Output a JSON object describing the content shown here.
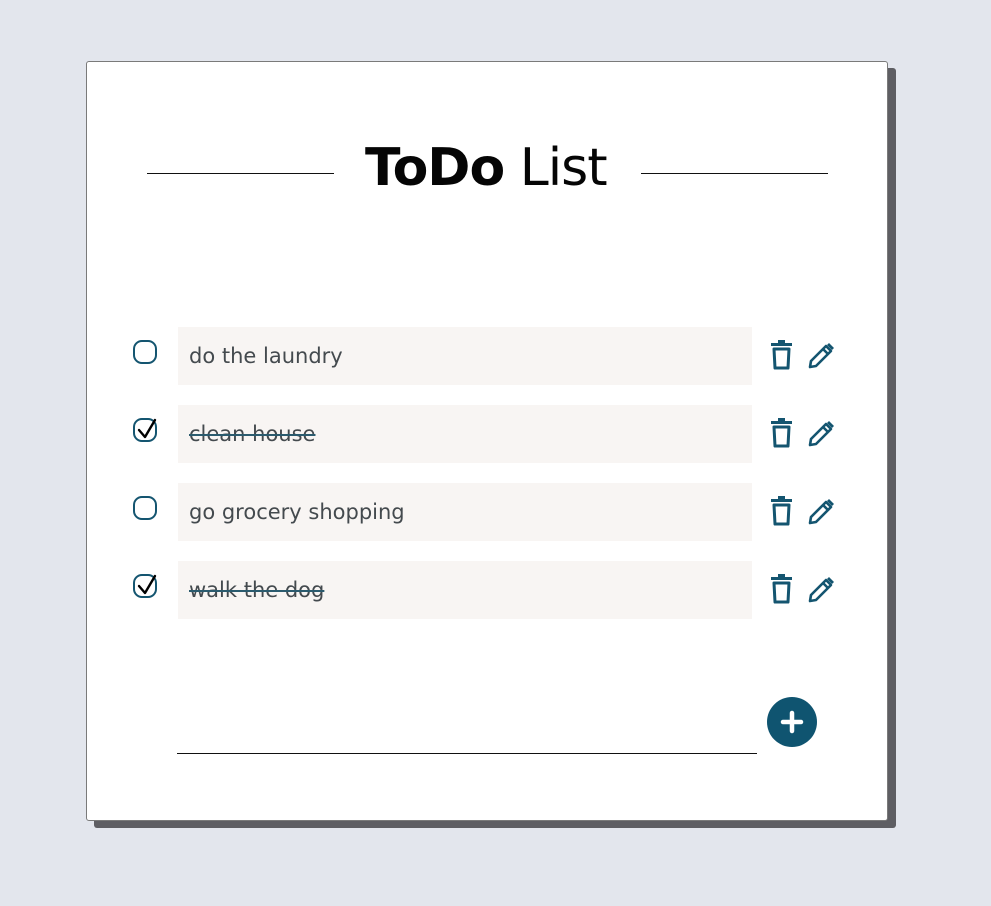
{
  "title": {
    "bold_part": "ToDo",
    "light_part": "List"
  },
  "tasks": [
    {
      "text": "do the laundry",
      "done": false
    },
    {
      "text": "clean house",
      "done": true
    },
    {
      "text": "go grocery shopping",
      "done": false
    },
    {
      "text": "walk the dog",
      "done": true
    }
  ],
  "new_task": {
    "value": "",
    "placeholder": ""
  },
  "icons": {
    "checkbox": "circle-checkbox-icon",
    "delete": "trash-icon",
    "edit": "pencil-icon",
    "add": "plus-icon"
  },
  "colors": {
    "accent": "#0f5470",
    "background": "#e3e6ed",
    "task_background": "#f8f5f3"
  }
}
